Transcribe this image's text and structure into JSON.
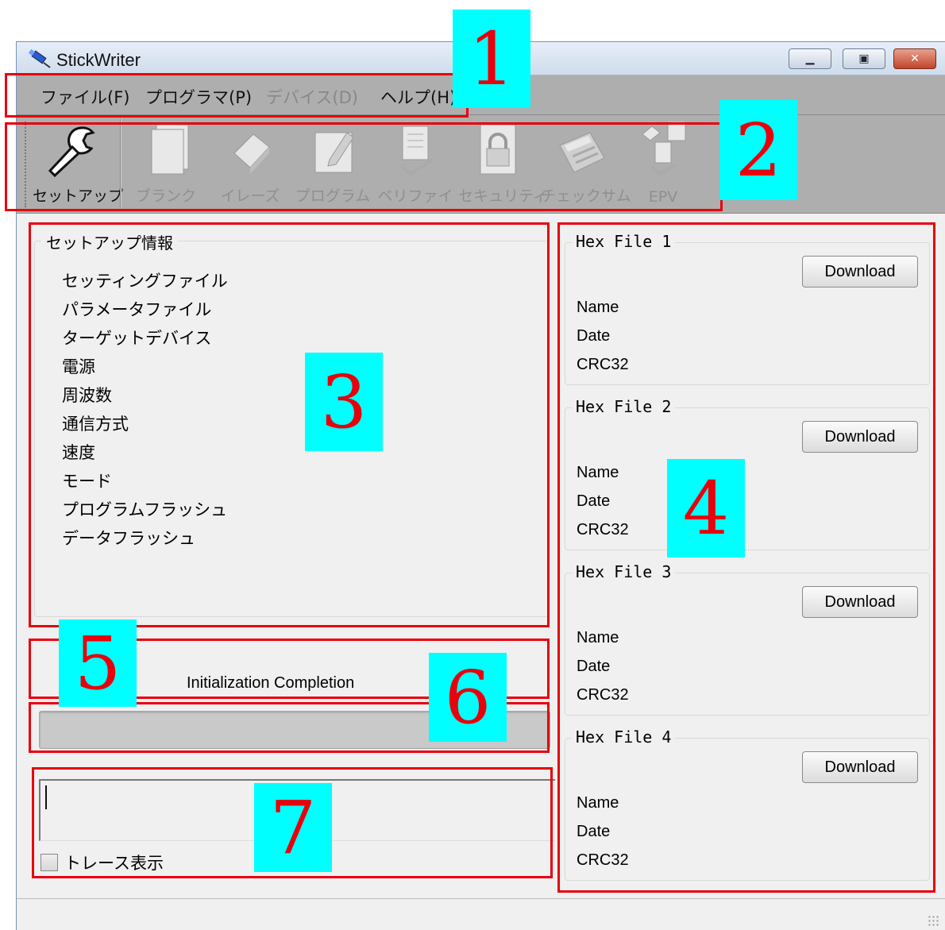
{
  "window": {
    "title": "StickWriter"
  },
  "menu": [
    {
      "label": "ファイル(F)",
      "enabled": true
    },
    {
      "label": "プログラマ(P)",
      "enabled": true
    },
    {
      "label": "デバイス(D)",
      "enabled": false
    },
    {
      "label": "ヘルプ(H)",
      "enabled": true
    }
  ],
  "toolbar": [
    {
      "label": "セットアップ",
      "icon": "wrench-icon",
      "active": true
    },
    {
      "label": "ブランク",
      "icon": "blank-icon",
      "active": false
    },
    {
      "label": "イレーズ",
      "icon": "eraser-icon",
      "active": false
    },
    {
      "label": "プログラム",
      "icon": "pencil-icon",
      "active": false
    },
    {
      "label": "ベリファイ",
      "icon": "verify-icon",
      "active": false
    },
    {
      "label": "セキュリティ",
      "icon": "lock-icon",
      "active": false
    },
    {
      "label": "チェックサム",
      "icon": "calculator-icon",
      "active": false
    },
    {
      "label": "EPV",
      "icon": "epv-icon",
      "active": false
    }
  ],
  "setup_info": {
    "title": "セットアップ情報",
    "items": [
      "セッティングファイル",
      "パラメータファイル",
      "ターゲットデバイス",
      "電源",
      "周波数",
      "通信方式",
      "速度",
      "モード",
      "プログラムフラッシュ",
      "データフラッシュ"
    ]
  },
  "hex_files": [
    {
      "title": "Hex File 1",
      "button": "Download",
      "fields": [
        "Name",
        "Date",
        "CRC32"
      ]
    },
    {
      "title": "Hex File 2",
      "button": "Download",
      "fields": [
        "Name",
        "Date",
        "CRC32"
      ]
    },
    {
      "title": "Hex File 3",
      "button": "Download",
      "fields": [
        "Name",
        "Date",
        "CRC32"
      ]
    },
    {
      "title": "Hex File 4",
      "button": "Download",
      "fields": [
        "Name",
        "Date",
        "CRC32"
      ]
    }
  ],
  "status": {
    "message": "Initialization Completion",
    "progress": 0
  },
  "trace": {
    "checkbox_label": "トレース表示",
    "checked": false
  },
  "annotations": [
    "1",
    "2",
    "3",
    "4",
    "5",
    "6",
    "7"
  ],
  "colors": {
    "annotation_border": "#e8000b",
    "annotation_badge": "#00ffff",
    "toolbar_bg": "#aeaeae"
  }
}
